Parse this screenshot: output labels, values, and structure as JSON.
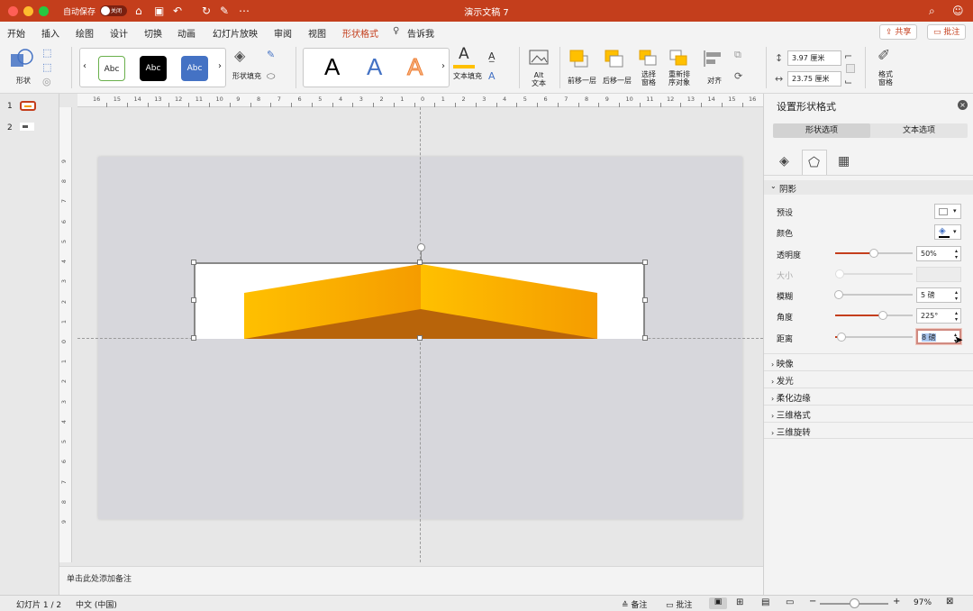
{
  "window": {
    "title": "演示文稿 7",
    "autosave_label": "自动保存",
    "autosave_state": "关闭"
  },
  "tabs": [
    "开始",
    "插入",
    "绘图",
    "设计",
    "切换",
    "动画",
    "幻灯片放映",
    "审阅",
    "视图",
    "形状格式",
    "告诉我"
  ],
  "active_tab": "形状格式",
  "header_buttons": {
    "share": "共享",
    "comments": "批注"
  },
  "ribbon": {
    "shape_label": "形状",
    "style_gallery": [
      "Abc",
      "Abc",
      "Abc"
    ],
    "shape_fill": "形状填充",
    "wordart": [
      "A",
      "A",
      "A"
    ],
    "text_fill": "文本填充",
    "alt_text": "Alt\n文本",
    "bring_forward": "前移一层",
    "send_backward": "后移一层",
    "selection_pane": "选择\n窗格",
    "reorder": "重新排\n序对象",
    "align": "对齐",
    "height": "3.97 厘米",
    "width": "23.75 厘米",
    "format_pane": "格式\n窗格"
  },
  "slides": [
    {
      "number": "1"
    },
    {
      "number": "2"
    }
  ],
  "ruler": {
    "h_labels": [
      "16",
      "15",
      "14",
      "13",
      "12",
      "11",
      "10",
      "9",
      "8",
      "7",
      "6",
      "5",
      "4",
      "3",
      "2",
      "1",
      "0",
      "1",
      "2",
      "3",
      "4",
      "5",
      "6",
      "7",
      "8",
      "9",
      "10",
      "11",
      "12",
      "13",
      "14",
      "15",
      "16"
    ],
    "v_labels": [
      "9",
      "8",
      "7",
      "6",
      "5",
      "4",
      "3",
      "2",
      "1",
      "0",
      "1",
      "2",
      "3",
      "4",
      "5",
      "6",
      "7",
      "8",
      "9"
    ]
  },
  "notes_placeholder": "单击此处添加备注",
  "status": {
    "slide": "幻灯片 1 / 2",
    "language": "中文 (中国)",
    "notes": "备注",
    "comments": "批注",
    "zoom": "97%"
  },
  "pane": {
    "title": "设置形状格式",
    "tab_shape": "形状选项",
    "tab_text": "文本选项",
    "shadow": {
      "header": "阴影",
      "preset": "预设",
      "color": "颜色",
      "transparency": {
        "label": "透明度",
        "value": "50%",
        "level": 0.5
      },
      "size": {
        "label": "大小",
        "value": ""
      },
      "blur": {
        "label": "模糊",
        "value": "5 磅",
        "level": 0.05
      },
      "angle": {
        "label": "角度",
        "value": "225°",
        "level": 0.62
      },
      "distance": {
        "label": "距离",
        "value": "8 磅",
        "level": 0.08
      }
    },
    "sections": [
      "映像",
      "发光",
      "柔化边缘",
      "三维格式",
      "三维旋转"
    ]
  },
  "colors": {
    "accent": "#c43e1c",
    "orange_light": "#ffc000",
    "orange_dark": "#f59c00",
    "shadow": "#b8640a"
  }
}
